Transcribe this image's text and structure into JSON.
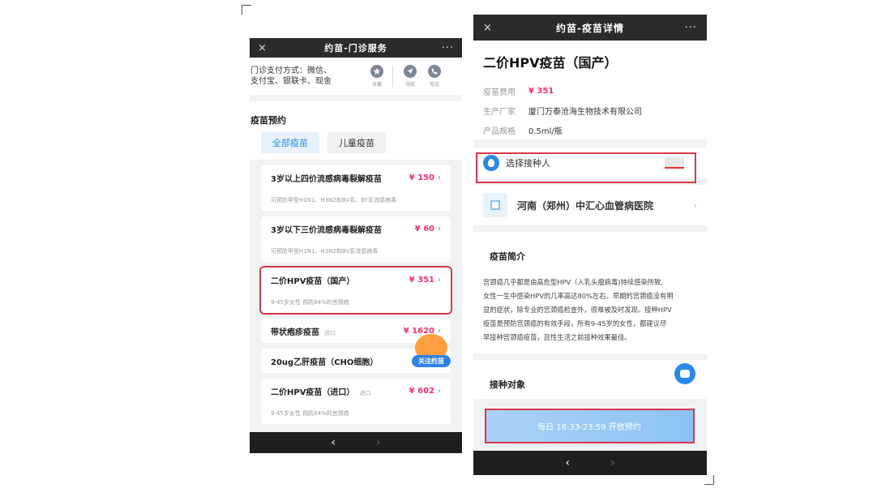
{
  "left": {
    "topbar": {
      "close": "×",
      "title": "约苗-门诊服务",
      "more": "···"
    },
    "payment": {
      "line1": "门诊支付方式：微信、",
      "line2": "支付宝、银联卡、现金"
    },
    "head_icons": [
      {
        "name": "star-icon",
        "label": "收藏"
      },
      {
        "name": "navigation-icon",
        "label": "导航"
      },
      {
        "name": "phone-icon",
        "label": "电话"
      }
    ],
    "section_title": "疫苗预约",
    "tabs": [
      {
        "label": "全部疫苗",
        "active": true
      },
      {
        "label": "儿童疫苗",
        "active": false
      }
    ],
    "vaccines": [
      {
        "name": "3岁以上四价流感病毒裂解疫苗",
        "tag": "",
        "price": "¥ 150",
        "desc": "可预防甲型H1N1、H3N2和BV系、BY系流感病毒"
      },
      {
        "name": "3岁以下三价流感病毒裂解疫苗",
        "tag": "",
        "price": "¥ 60",
        "desc": "可预防甲型H1N1、H3N2和BV系流感病毒"
      },
      {
        "name": "二价HPV疫苗（国产）",
        "tag": "",
        "price": "¥ 351",
        "desc": "9-45岁女性 预防84%的宫颈癌"
      },
      {
        "name": "带状疱疹疫苗",
        "tag": "进口",
        "price": "¥ 1620",
        "desc": ""
      },
      {
        "name": "20ug乙肝疫苗（CHO细胞）",
        "tag": "",
        "price": "",
        "desc": ""
      },
      {
        "name": "二价HPV疫苗（进口）",
        "tag": "进口",
        "price": "¥ 602",
        "desc": "9-45岁女性 预防84%的宫颈癌"
      }
    ],
    "follow_label": "关注约苗",
    "nav": {
      "back": "‹",
      "forward": "›"
    }
  },
  "right": {
    "topbar": {
      "close": "×",
      "title": "约苗-疫苗详情",
      "more": "···"
    },
    "vaccine_title": "二价HPV疫苗（国产）",
    "info": [
      {
        "key": "疫苗费用",
        "value": "¥ 351",
        "price": true
      },
      {
        "key": "生产厂家",
        "value": "厦门万泰沧海生物技术有限公司",
        "price": false
      },
      {
        "key": "产品规格",
        "value": "0.5ml/瓶",
        "price": false
      }
    ],
    "select_person": "选择接种人",
    "hospital": "河南（郑州）中汇心血管病医院",
    "intro_title": "疫苗简介",
    "intro_lines": [
      "宫颈癌几乎都是由高危型HPV（人乳头瘤病毒)持续感染所致,",
      "女性一生中感染HPV的几率高达80%左右。早期的宫颈癌没有明",
      "显的症状，除专业的宫颈癌检查外，很难被及时发现。接种HPV",
      "疫苗是预防宫颈癌的有效手段，所有9-45岁的女性，都建议尽",
      "早接种宫颈癌疫苗，且性生活之前接种效果最佳。"
    ],
    "target_title": "接种对象",
    "book_button": "每日 16:33-23:59 开放预约",
    "nav": {
      "back": "‹",
      "forward": "›"
    }
  }
}
